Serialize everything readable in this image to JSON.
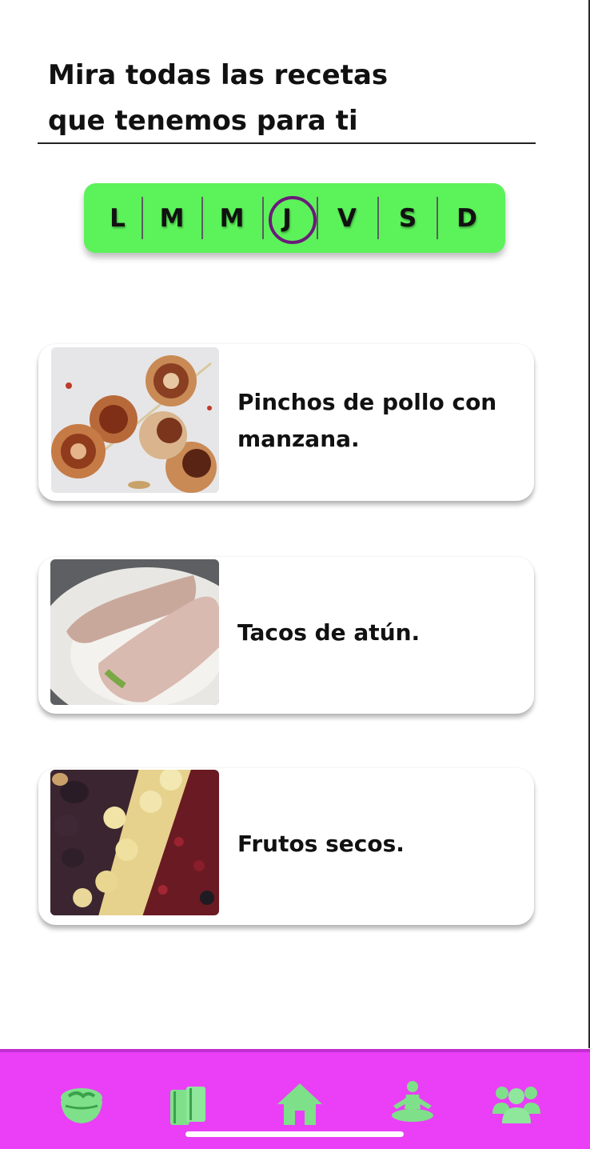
{
  "header": {
    "title_line1": "Mira todas las recetas",
    "title_line2": "que tenemos para ti"
  },
  "days": {
    "items": [
      "L",
      "M",
      "M",
      "J",
      "V",
      "S",
      "D"
    ],
    "selected": "J",
    "bar_color": "#5cf25a",
    "selection_color": "#6b1a7b"
  },
  "recipes": [
    {
      "title": "Pinchos de pollo con manzana.",
      "image": "chicken-skewers-photo"
    },
    {
      "title": "Tacos de atún.",
      "image": "tuna-wraps-photo"
    },
    {
      "title": "Frutos secos.",
      "image": "dried-fruits-nuts-photo"
    }
  ],
  "bottom_nav": {
    "background": "#ea3ff6",
    "icon_color": "#7fe08a",
    "items": [
      {
        "icon": "salad-bowl-icon"
      },
      {
        "icon": "books-icon"
      },
      {
        "icon": "home-icon"
      },
      {
        "icon": "meditation-icon"
      },
      {
        "icon": "community-icon"
      }
    ]
  }
}
